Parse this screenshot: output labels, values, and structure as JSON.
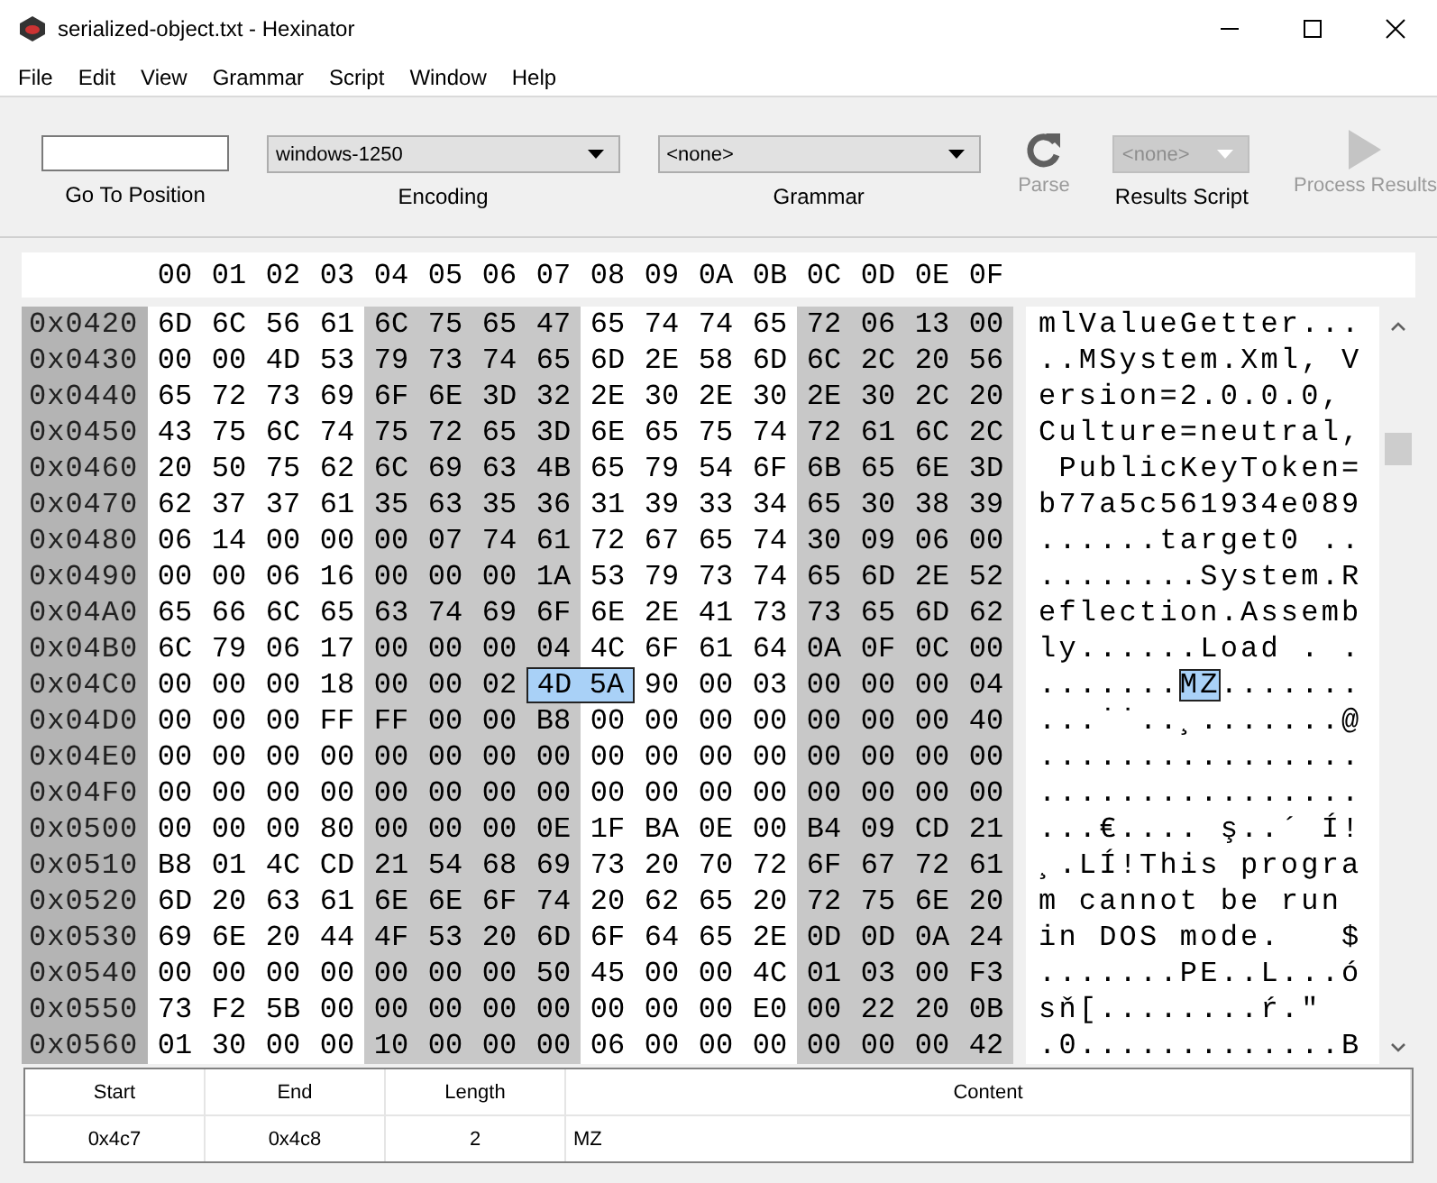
{
  "window": {
    "title": "serialized-object.txt - Hexinator"
  },
  "menu": [
    "File",
    "Edit",
    "View",
    "Grammar",
    "Script",
    "Window",
    "Help"
  ],
  "toolbar": {
    "go_to_position": {
      "label": "Go To Position"
    },
    "encoding": {
      "value": "windows-1250",
      "label": "Encoding"
    },
    "grammar": {
      "value": "<none>",
      "label": "Grammar"
    },
    "parse": {
      "label": "Parse",
      "disabled": true
    },
    "results_script": {
      "value": "<none>",
      "label": "Results Script",
      "disabled": true
    },
    "process_results": {
      "label": "Process Results",
      "disabled": true
    }
  },
  "hex_view": {
    "columns": [
      "00",
      "01",
      "02",
      "03",
      "04",
      "05",
      "06",
      "07",
      "08",
      "09",
      "0A",
      "0B",
      "0C",
      "0D",
      "0E",
      "0F"
    ],
    "rows": [
      {
        "address": "0x0420",
        "bytes": [
          {
            "hex": "6D",
            "selected": false
          },
          {
            "hex": "6C",
            "selected": false
          },
          {
            "hex": "56",
            "selected": false
          },
          {
            "hex": "61",
            "selected": false
          },
          {
            "hex": "6C",
            "selected": false
          },
          {
            "hex": "75",
            "selected": false
          },
          {
            "hex": "65",
            "selected": false
          },
          {
            "hex": "47",
            "selected": false
          },
          {
            "hex": "65",
            "selected": false
          },
          {
            "hex": "74",
            "selected": false
          },
          {
            "hex": "74",
            "selected": false
          },
          {
            "hex": "65",
            "selected": false
          },
          {
            "hex": "72",
            "selected": false
          },
          {
            "hex": "06",
            "selected": false
          },
          {
            "hex": "13",
            "selected": false
          },
          {
            "hex": "00",
            "selected": false
          }
        ],
        "ascii": [
          {
            "text": "mlValueGetter...",
            "selected": false
          }
        ]
      },
      {
        "address": "0x0430",
        "bytes": [
          {
            "hex": "00",
            "selected": false
          },
          {
            "hex": "00",
            "selected": false
          },
          {
            "hex": "4D",
            "selected": false
          },
          {
            "hex": "53",
            "selected": false
          },
          {
            "hex": "79",
            "selected": false
          },
          {
            "hex": "73",
            "selected": false
          },
          {
            "hex": "74",
            "selected": false
          },
          {
            "hex": "65",
            "selected": false
          },
          {
            "hex": "6D",
            "selected": false
          },
          {
            "hex": "2E",
            "selected": false
          },
          {
            "hex": "58",
            "selected": false
          },
          {
            "hex": "6D",
            "selected": false
          },
          {
            "hex": "6C",
            "selected": false
          },
          {
            "hex": "2C",
            "selected": false
          },
          {
            "hex": "20",
            "selected": false
          },
          {
            "hex": "56",
            "selected": false
          }
        ],
        "ascii": [
          {
            "text": "..MSystem.Xml, V",
            "selected": false
          }
        ]
      },
      {
        "address": "0x0440",
        "bytes": [
          {
            "hex": "65",
            "selected": false
          },
          {
            "hex": "72",
            "selected": false
          },
          {
            "hex": "73",
            "selected": false
          },
          {
            "hex": "69",
            "selected": false
          },
          {
            "hex": "6F",
            "selected": false
          },
          {
            "hex": "6E",
            "selected": false
          },
          {
            "hex": "3D",
            "selected": false
          },
          {
            "hex": "32",
            "selected": false
          },
          {
            "hex": "2E",
            "selected": false
          },
          {
            "hex": "30",
            "selected": false
          },
          {
            "hex": "2E",
            "selected": false
          },
          {
            "hex": "30",
            "selected": false
          },
          {
            "hex": "2E",
            "selected": false
          },
          {
            "hex": "30",
            "selected": false
          },
          {
            "hex": "2C",
            "selected": false
          },
          {
            "hex": "20",
            "selected": false
          }
        ],
        "ascii": [
          {
            "text": "ersion=2.0.0.0,",
            "selected": false
          }
        ]
      },
      {
        "address": "0x0450",
        "bytes": [
          {
            "hex": "43",
            "selected": false
          },
          {
            "hex": "75",
            "selected": false
          },
          {
            "hex": "6C",
            "selected": false
          },
          {
            "hex": "74",
            "selected": false
          },
          {
            "hex": "75",
            "selected": false
          },
          {
            "hex": "72",
            "selected": false
          },
          {
            "hex": "65",
            "selected": false
          },
          {
            "hex": "3D",
            "selected": false
          },
          {
            "hex": "6E",
            "selected": false
          },
          {
            "hex": "65",
            "selected": false
          },
          {
            "hex": "75",
            "selected": false
          },
          {
            "hex": "74",
            "selected": false
          },
          {
            "hex": "72",
            "selected": false
          },
          {
            "hex": "61",
            "selected": false
          },
          {
            "hex": "6C",
            "selected": false
          },
          {
            "hex": "2C",
            "selected": false
          }
        ],
        "ascii": [
          {
            "text": "Culture=neutral,",
            "selected": false
          }
        ]
      },
      {
        "address": "0x0460",
        "bytes": [
          {
            "hex": "20",
            "selected": false
          },
          {
            "hex": "50",
            "selected": false
          },
          {
            "hex": "75",
            "selected": false
          },
          {
            "hex": "62",
            "selected": false
          },
          {
            "hex": "6C",
            "selected": false
          },
          {
            "hex": "69",
            "selected": false
          },
          {
            "hex": "63",
            "selected": false
          },
          {
            "hex": "4B",
            "selected": false
          },
          {
            "hex": "65",
            "selected": false
          },
          {
            "hex": "79",
            "selected": false
          },
          {
            "hex": "54",
            "selected": false
          },
          {
            "hex": "6F",
            "selected": false
          },
          {
            "hex": "6B",
            "selected": false
          },
          {
            "hex": "65",
            "selected": false
          },
          {
            "hex": "6E",
            "selected": false
          },
          {
            "hex": "3D",
            "selected": false
          }
        ],
        "ascii": [
          {
            "text": " PublicKeyToken=",
            "selected": false
          }
        ]
      },
      {
        "address": "0x0470",
        "bytes": [
          {
            "hex": "62",
            "selected": false
          },
          {
            "hex": "37",
            "selected": false
          },
          {
            "hex": "37",
            "selected": false
          },
          {
            "hex": "61",
            "selected": false
          },
          {
            "hex": "35",
            "selected": false
          },
          {
            "hex": "63",
            "selected": false
          },
          {
            "hex": "35",
            "selected": false
          },
          {
            "hex": "36",
            "selected": false
          },
          {
            "hex": "31",
            "selected": false
          },
          {
            "hex": "39",
            "selected": false
          },
          {
            "hex": "33",
            "selected": false
          },
          {
            "hex": "34",
            "selected": false
          },
          {
            "hex": "65",
            "selected": false
          },
          {
            "hex": "30",
            "selected": false
          },
          {
            "hex": "38",
            "selected": false
          },
          {
            "hex": "39",
            "selected": false
          }
        ],
        "ascii": [
          {
            "text": "b77a5c561934e089",
            "selected": false
          }
        ]
      },
      {
        "address": "0x0480",
        "bytes": [
          {
            "hex": "06",
            "selected": false
          },
          {
            "hex": "14",
            "selected": false
          },
          {
            "hex": "00",
            "selected": false
          },
          {
            "hex": "00",
            "selected": false
          },
          {
            "hex": "00",
            "selected": false
          },
          {
            "hex": "07",
            "selected": false
          },
          {
            "hex": "74",
            "selected": false
          },
          {
            "hex": "61",
            "selected": false
          },
          {
            "hex": "72",
            "selected": false
          },
          {
            "hex": "67",
            "selected": false
          },
          {
            "hex": "65",
            "selected": false
          },
          {
            "hex": "74",
            "selected": false
          },
          {
            "hex": "30",
            "selected": false
          },
          {
            "hex": "09",
            "selected": false
          },
          {
            "hex": "06",
            "selected": false
          },
          {
            "hex": "00",
            "selected": false
          }
        ],
        "ascii": [
          {
            "text": "......target0 ..",
            "selected": false
          }
        ]
      },
      {
        "address": "0x0490",
        "bytes": [
          {
            "hex": "00",
            "selected": false
          },
          {
            "hex": "00",
            "selected": false
          },
          {
            "hex": "06",
            "selected": false
          },
          {
            "hex": "16",
            "selected": false
          },
          {
            "hex": "00",
            "selected": false
          },
          {
            "hex": "00",
            "selected": false
          },
          {
            "hex": "00",
            "selected": false
          },
          {
            "hex": "1A",
            "selected": false
          },
          {
            "hex": "53",
            "selected": false
          },
          {
            "hex": "79",
            "selected": false
          },
          {
            "hex": "73",
            "selected": false
          },
          {
            "hex": "74",
            "selected": false
          },
          {
            "hex": "65",
            "selected": false
          },
          {
            "hex": "6D",
            "selected": false
          },
          {
            "hex": "2E",
            "selected": false
          },
          {
            "hex": "52",
            "selected": false
          }
        ],
        "ascii": [
          {
            "text": "........System.R",
            "selected": false
          }
        ]
      },
      {
        "address": "0x04A0",
        "bytes": [
          {
            "hex": "65",
            "selected": false
          },
          {
            "hex": "66",
            "selected": false
          },
          {
            "hex": "6C",
            "selected": false
          },
          {
            "hex": "65",
            "selected": false
          },
          {
            "hex": "63",
            "selected": false
          },
          {
            "hex": "74",
            "selected": false
          },
          {
            "hex": "69",
            "selected": false
          },
          {
            "hex": "6F",
            "selected": false
          },
          {
            "hex": "6E",
            "selected": false
          },
          {
            "hex": "2E",
            "selected": false
          },
          {
            "hex": "41",
            "selected": false
          },
          {
            "hex": "73",
            "selected": false
          },
          {
            "hex": "73",
            "selected": false
          },
          {
            "hex": "65",
            "selected": false
          },
          {
            "hex": "6D",
            "selected": false
          },
          {
            "hex": "62",
            "selected": false
          }
        ],
        "ascii": [
          {
            "text": "eflection.Assemb",
            "selected": false
          }
        ]
      },
      {
        "address": "0x04B0",
        "bytes": [
          {
            "hex": "6C",
            "selected": false
          },
          {
            "hex": "79",
            "selected": false
          },
          {
            "hex": "06",
            "selected": false
          },
          {
            "hex": "17",
            "selected": false
          },
          {
            "hex": "00",
            "selected": false
          },
          {
            "hex": "00",
            "selected": false
          },
          {
            "hex": "00",
            "selected": false
          },
          {
            "hex": "04",
            "selected": false
          },
          {
            "hex": "4C",
            "selected": false
          },
          {
            "hex": "6F",
            "selected": false
          },
          {
            "hex": "61",
            "selected": false
          },
          {
            "hex": "64",
            "selected": false
          },
          {
            "hex": "0A",
            "selected": false
          },
          {
            "hex": "0F",
            "selected": false
          },
          {
            "hex": "0C",
            "selected": false
          },
          {
            "hex": "00",
            "selected": false
          }
        ],
        "ascii": [
          {
            "text": "ly......Load . .",
            "selected": false
          }
        ]
      },
      {
        "address": "0x04C0",
        "bytes": [
          {
            "hex": "00",
            "selected": false
          },
          {
            "hex": "00",
            "selected": false
          },
          {
            "hex": "00",
            "selected": false
          },
          {
            "hex": "18",
            "selected": false
          },
          {
            "hex": "00",
            "selected": false
          },
          {
            "hex": "00",
            "selected": false
          },
          {
            "hex": "02",
            "selected": false
          },
          {
            "hex": "4D",
            "selected": true
          },
          {
            "hex": "5A",
            "selected": true
          },
          {
            "hex": "90",
            "selected": false
          },
          {
            "hex": "00",
            "selected": false
          },
          {
            "hex": "03",
            "selected": false
          },
          {
            "hex": "00",
            "selected": false
          },
          {
            "hex": "00",
            "selected": false
          },
          {
            "hex": "00",
            "selected": false
          },
          {
            "hex": "04",
            "selected": false
          }
        ],
        "ascii": [
          {
            "text": ".......",
            "selected": false
          },
          {
            "text": "MZ",
            "selected": true
          },
          {
            "text": ".......",
            "selected": false
          }
        ]
      },
      {
        "address": "0x04D0",
        "bytes": [
          {
            "hex": "00",
            "selected": false
          },
          {
            "hex": "00",
            "selected": false
          },
          {
            "hex": "00",
            "selected": false
          },
          {
            "hex": "FF",
            "selected": false
          },
          {
            "hex": "FF",
            "selected": false
          },
          {
            "hex": "00",
            "selected": false
          },
          {
            "hex": "00",
            "selected": false
          },
          {
            "hex": "B8",
            "selected": false
          },
          {
            "hex": "00",
            "selected": false
          },
          {
            "hex": "00",
            "selected": false
          },
          {
            "hex": "00",
            "selected": false
          },
          {
            "hex": "00",
            "selected": false
          },
          {
            "hex": "00",
            "selected": false
          },
          {
            "hex": "00",
            "selected": false
          },
          {
            "hex": "00",
            "selected": false
          },
          {
            "hex": "40",
            "selected": false
          }
        ],
        "ascii": [
          {
            "text": "...˙˙..¸.......@",
            "selected": false
          }
        ]
      },
      {
        "address": "0x04E0",
        "bytes": [
          {
            "hex": "00",
            "selected": false
          },
          {
            "hex": "00",
            "selected": false
          },
          {
            "hex": "00",
            "selected": false
          },
          {
            "hex": "00",
            "selected": false
          },
          {
            "hex": "00",
            "selected": false
          },
          {
            "hex": "00",
            "selected": false
          },
          {
            "hex": "00",
            "selected": false
          },
          {
            "hex": "00",
            "selected": false
          },
          {
            "hex": "00",
            "selected": false
          },
          {
            "hex": "00",
            "selected": false
          },
          {
            "hex": "00",
            "selected": false
          },
          {
            "hex": "00",
            "selected": false
          },
          {
            "hex": "00",
            "selected": false
          },
          {
            "hex": "00",
            "selected": false
          },
          {
            "hex": "00",
            "selected": false
          },
          {
            "hex": "00",
            "selected": false
          }
        ],
        "ascii": [
          {
            "text": "................",
            "selected": false
          }
        ]
      },
      {
        "address": "0x04F0",
        "bytes": [
          {
            "hex": "00",
            "selected": false
          },
          {
            "hex": "00",
            "selected": false
          },
          {
            "hex": "00",
            "selected": false
          },
          {
            "hex": "00",
            "selected": false
          },
          {
            "hex": "00",
            "selected": false
          },
          {
            "hex": "00",
            "selected": false
          },
          {
            "hex": "00",
            "selected": false
          },
          {
            "hex": "00",
            "selected": false
          },
          {
            "hex": "00",
            "selected": false
          },
          {
            "hex": "00",
            "selected": false
          },
          {
            "hex": "00",
            "selected": false
          },
          {
            "hex": "00",
            "selected": false
          },
          {
            "hex": "00",
            "selected": false
          },
          {
            "hex": "00",
            "selected": false
          },
          {
            "hex": "00",
            "selected": false
          },
          {
            "hex": "00",
            "selected": false
          }
        ],
        "ascii": [
          {
            "text": "................",
            "selected": false
          }
        ]
      },
      {
        "address": "0x0500",
        "bytes": [
          {
            "hex": "00",
            "selected": false
          },
          {
            "hex": "00",
            "selected": false
          },
          {
            "hex": "00",
            "selected": false
          },
          {
            "hex": "80",
            "selected": false
          },
          {
            "hex": "00",
            "selected": false
          },
          {
            "hex": "00",
            "selected": false
          },
          {
            "hex": "00",
            "selected": false
          },
          {
            "hex": "0E",
            "selected": false
          },
          {
            "hex": "1F",
            "selected": false
          },
          {
            "hex": "BA",
            "selected": false
          },
          {
            "hex": "0E",
            "selected": false
          },
          {
            "hex": "00",
            "selected": false
          },
          {
            "hex": "B4",
            "selected": false
          },
          {
            "hex": "09",
            "selected": false
          },
          {
            "hex": "CD",
            "selected": false
          },
          {
            "hex": "21",
            "selected": false
          }
        ],
        "ascii": [
          {
            "text": "...€.... ş..´ Í!",
            "selected": false
          }
        ]
      },
      {
        "address": "0x0510",
        "bytes": [
          {
            "hex": "B8",
            "selected": false
          },
          {
            "hex": "01",
            "selected": false
          },
          {
            "hex": "4C",
            "selected": false
          },
          {
            "hex": "CD",
            "selected": false
          },
          {
            "hex": "21",
            "selected": false
          },
          {
            "hex": "54",
            "selected": false
          },
          {
            "hex": "68",
            "selected": false
          },
          {
            "hex": "69",
            "selected": false
          },
          {
            "hex": "73",
            "selected": false
          },
          {
            "hex": "20",
            "selected": false
          },
          {
            "hex": "70",
            "selected": false
          },
          {
            "hex": "72",
            "selected": false
          },
          {
            "hex": "6F",
            "selected": false
          },
          {
            "hex": "67",
            "selected": false
          },
          {
            "hex": "72",
            "selected": false
          },
          {
            "hex": "61",
            "selected": false
          }
        ],
        "ascii": [
          {
            "text": "¸.LÍ!This progra",
            "selected": false
          }
        ]
      },
      {
        "address": "0x0520",
        "bytes": [
          {
            "hex": "6D",
            "selected": false
          },
          {
            "hex": "20",
            "selected": false
          },
          {
            "hex": "63",
            "selected": false
          },
          {
            "hex": "61",
            "selected": false
          },
          {
            "hex": "6E",
            "selected": false
          },
          {
            "hex": "6E",
            "selected": false
          },
          {
            "hex": "6F",
            "selected": false
          },
          {
            "hex": "74",
            "selected": false
          },
          {
            "hex": "20",
            "selected": false
          },
          {
            "hex": "62",
            "selected": false
          },
          {
            "hex": "65",
            "selected": false
          },
          {
            "hex": "20",
            "selected": false
          },
          {
            "hex": "72",
            "selected": false
          },
          {
            "hex": "75",
            "selected": false
          },
          {
            "hex": "6E",
            "selected": false
          },
          {
            "hex": "20",
            "selected": false
          }
        ],
        "ascii": [
          {
            "text": "m cannot be run",
            "selected": false
          }
        ]
      },
      {
        "address": "0x0530",
        "bytes": [
          {
            "hex": "69",
            "selected": false
          },
          {
            "hex": "6E",
            "selected": false
          },
          {
            "hex": "20",
            "selected": false
          },
          {
            "hex": "44",
            "selected": false
          },
          {
            "hex": "4F",
            "selected": false
          },
          {
            "hex": "53",
            "selected": false
          },
          {
            "hex": "20",
            "selected": false
          },
          {
            "hex": "6D",
            "selected": false
          },
          {
            "hex": "6F",
            "selected": false
          },
          {
            "hex": "64",
            "selected": false
          },
          {
            "hex": "65",
            "selected": false
          },
          {
            "hex": "2E",
            "selected": false
          },
          {
            "hex": "0D",
            "selected": false
          },
          {
            "hex": "0D",
            "selected": false
          },
          {
            "hex": "0A",
            "selected": false
          },
          {
            "hex": "24",
            "selected": false
          }
        ],
        "ascii": [
          {
            "text": "in DOS mode.   $",
            "selected": false
          }
        ]
      },
      {
        "address": "0x0540",
        "bytes": [
          {
            "hex": "00",
            "selected": false
          },
          {
            "hex": "00",
            "selected": false
          },
          {
            "hex": "00",
            "selected": false
          },
          {
            "hex": "00",
            "selected": false
          },
          {
            "hex": "00",
            "selected": false
          },
          {
            "hex": "00",
            "selected": false
          },
          {
            "hex": "00",
            "selected": false
          },
          {
            "hex": "50",
            "selected": false
          },
          {
            "hex": "45",
            "selected": false
          },
          {
            "hex": "00",
            "selected": false
          },
          {
            "hex": "00",
            "selected": false
          },
          {
            "hex": "4C",
            "selected": false
          },
          {
            "hex": "01",
            "selected": false
          },
          {
            "hex": "03",
            "selected": false
          },
          {
            "hex": "00",
            "selected": false
          },
          {
            "hex": "F3",
            "selected": false
          }
        ],
        "ascii": [
          {
            "text": ".......PE..L...ó",
            "selected": false
          }
        ]
      },
      {
        "address": "0x0550",
        "bytes": [
          {
            "hex": "73",
            "selected": false
          },
          {
            "hex": "F2",
            "selected": false
          },
          {
            "hex": "5B",
            "selected": false
          },
          {
            "hex": "00",
            "selected": false
          },
          {
            "hex": "00",
            "selected": false
          },
          {
            "hex": "00",
            "selected": false
          },
          {
            "hex": "00",
            "selected": false
          },
          {
            "hex": "00",
            "selected": false
          },
          {
            "hex": "00",
            "selected": false
          },
          {
            "hex": "00",
            "selected": false
          },
          {
            "hex": "00",
            "selected": false
          },
          {
            "hex": "E0",
            "selected": false
          },
          {
            "hex": "00",
            "selected": false
          },
          {
            "hex": "22",
            "selected": false
          },
          {
            "hex": "20",
            "selected": false
          },
          {
            "hex": "0B",
            "selected": false
          }
        ],
        "ascii": [
          {
            "text": "sň[........ŕ.\"",
            "selected": false
          }
        ]
      },
      {
        "address": "0x0560",
        "bytes": [
          {
            "hex": "01",
            "selected": false
          },
          {
            "hex": "30",
            "selected": false
          },
          {
            "hex": "00",
            "selected": false
          },
          {
            "hex": "00",
            "selected": false
          },
          {
            "hex": "10",
            "selected": false
          },
          {
            "hex": "00",
            "selected": false
          },
          {
            "hex": "00",
            "selected": false
          },
          {
            "hex": "00",
            "selected": false
          },
          {
            "hex": "06",
            "selected": false
          },
          {
            "hex": "00",
            "selected": false
          },
          {
            "hex": "00",
            "selected": false
          },
          {
            "hex": "00",
            "selected": false
          },
          {
            "hex": "00",
            "selected": false
          },
          {
            "hex": "00",
            "selected": false
          },
          {
            "hex": "00",
            "selected": false
          },
          {
            "hex": "42",
            "selected": false
          }
        ],
        "ascii": [
          {
            "text": ".0.............B",
            "selected": false
          }
        ]
      }
    ]
  },
  "selection_table": {
    "columns": [
      "Start",
      "End",
      "Length",
      "Content"
    ],
    "rows": [
      [
        "0x4c7",
        "0x4c8",
        "2",
        "MZ"
      ]
    ]
  }
}
